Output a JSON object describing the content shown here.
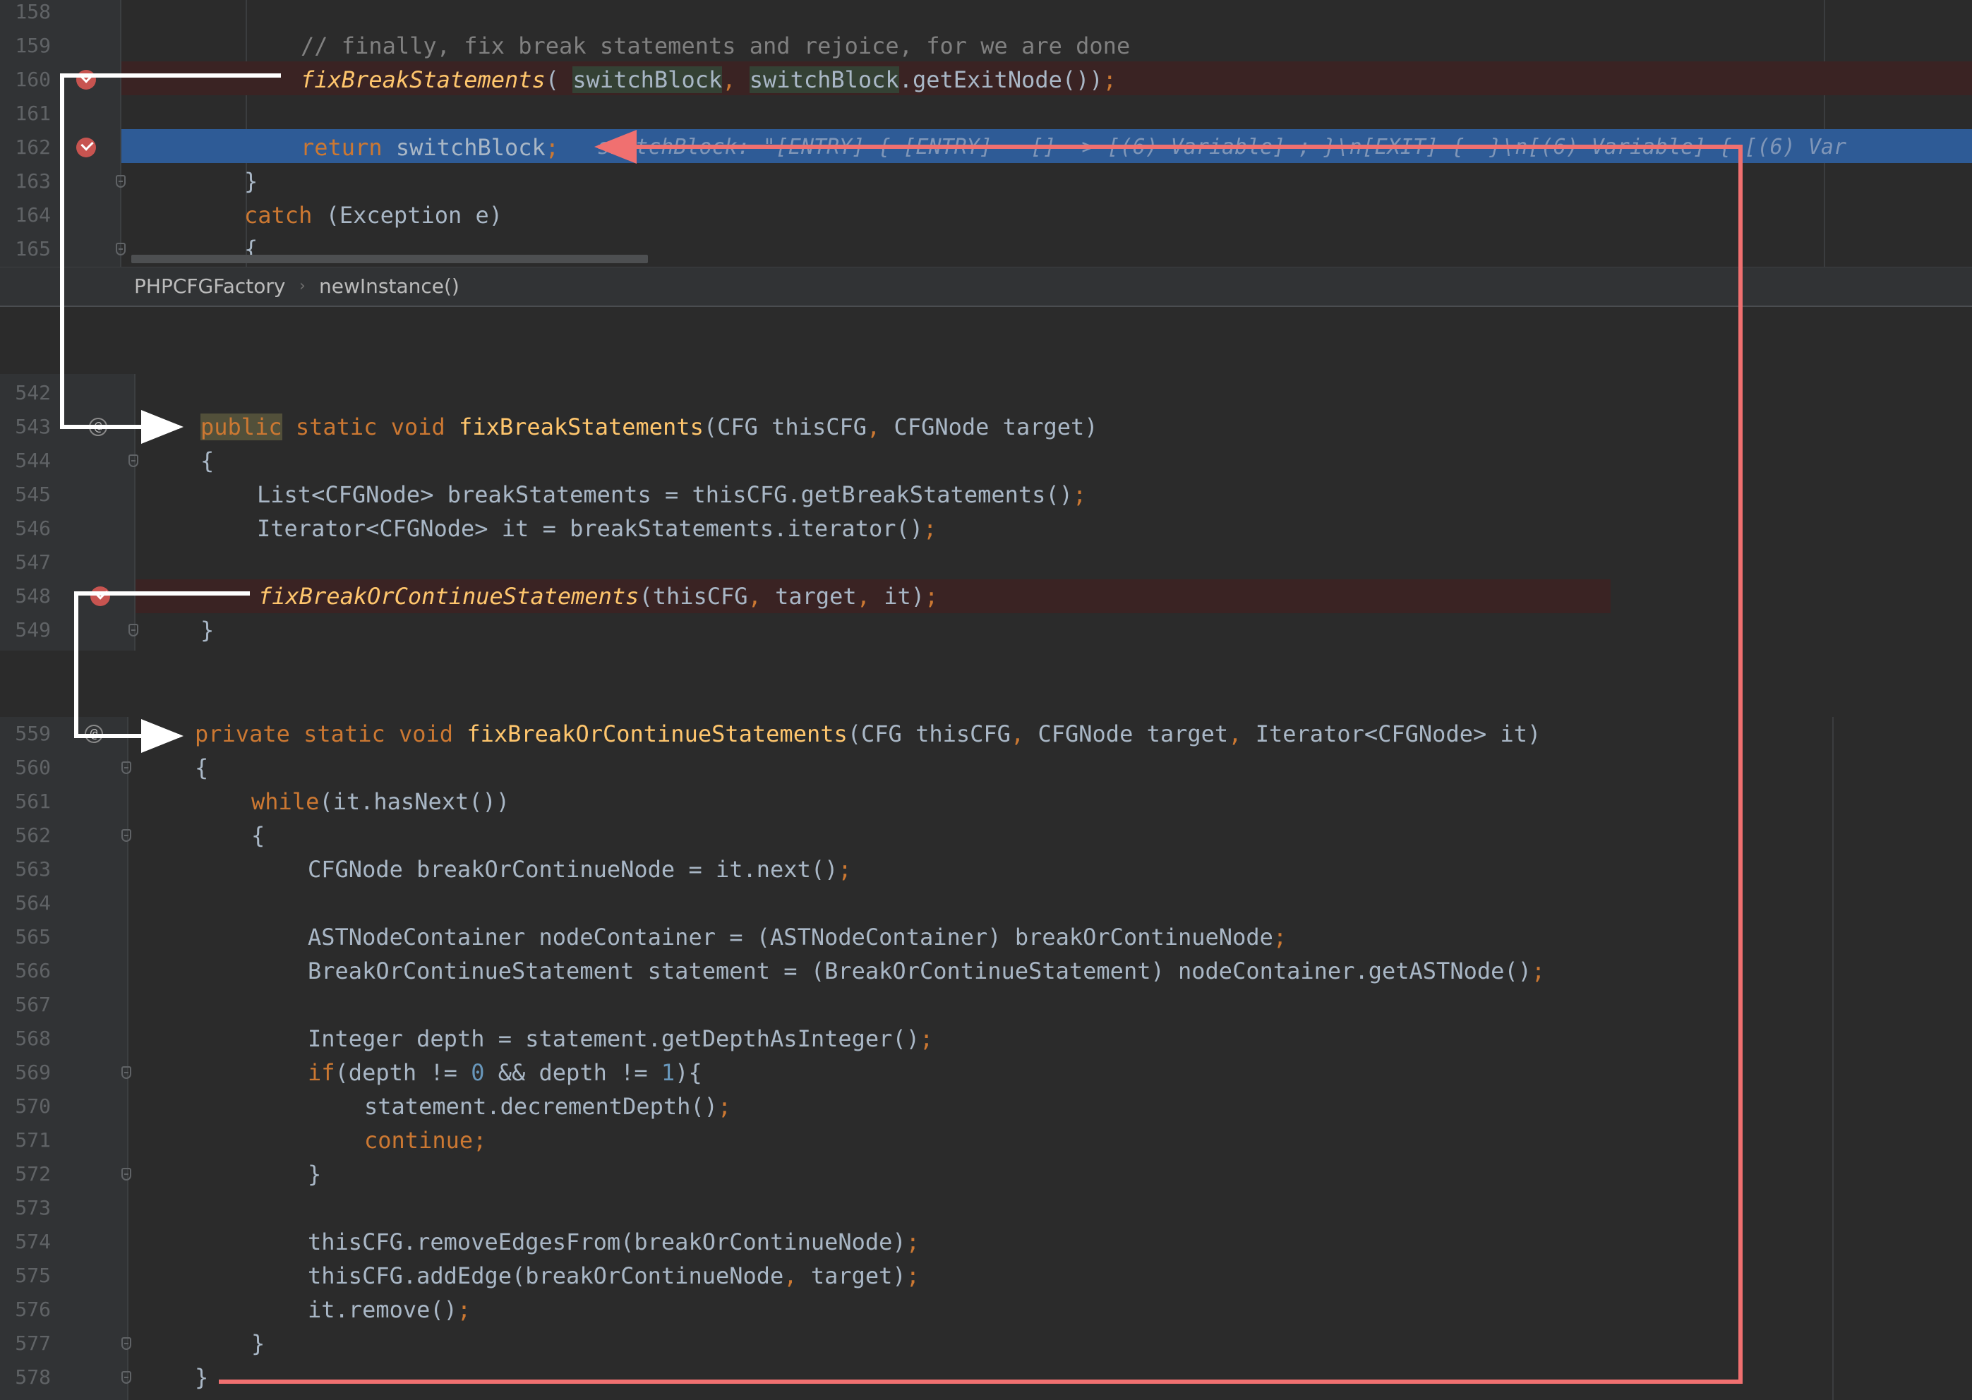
{
  "breadcrumb": {
    "class_name": "PHPCFGFactory",
    "separator": "›",
    "method_name": "newInstance()"
  },
  "icons": {
    "breakpoint": "breakpoint-verified-icon",
    "fold": "fold-icon",
    "override": "overrides-method-icon",
    "annotation_arrow": "arrow-icon"
  },
  "colors": {
    "background": "#2b2b2b",
    "keyword": "#cc7832",
    "method": "#ffc66d",
    "comment": "#808080",
    "number": "#6897bb",
    "breakpoint": "#c75450",
    "execution_line": "#2e5b96",
    "annotation_white": "#ffffff",
    "annotation_red": "#f07070"
  },
  "top_editor": {
    "lines": [
      {
        "no": "158",
        "comment": ""
      },
      {
        "no": "159",
        "comment": "// finally, fix break statements and rejoice, for we are done"
      },
      {
        "no": "160",
        "method": "fixBreakStatements",
        "p1": "( ",
        "arg1": "switchBlock",
        "comma1": ", ",
        "arg2": "switchBlock",
        "rest": ".getExitNode())",
        "semi": ";"
      },
      {
        "no": "161"
      },
      {
        "no": "162",
        "kw": "return",
        "rest": " switchBlock",
        "semi": ";",
        "inlay": "switchBlock: \"[ENTRY] { [ENTRY] --[]--> [(6) Variable] ; }\\n[EXIT] {  }\\n[(6) Variable] { [(6) Var"
      },
      {
        "no": "163",
        "text": "}"
      },
      {
        "no": "164",
        "kw": "catch",
        "rest": " (Exception e)"
      },
      {
        "no": "165",
        "text": "{"
      }
    ]
  },
  "middle_editor": {
    "lines": [
      {
        "no": "542"
      },
      {
        "no": "543",
        "kw1": "public",
        "kw2": " static void ",
        "method": "fixBreakStatements",
        "rest1": "(CFG thisCFG",
        "comma": ", ",
        "rest2": "CFGNode target)"
      },
      {
        "no": "544",
        "text": "{"
      },
      {
        "no": "545",
        "text": "List<CFGNode> breakStatements = thisCFG.getBreakStatements()",
        "semi": ";"
      },
      {
        "no": "546",
        "text": "Iterator<CFGNode> it = breakStatements.iterator()",
        "semi": ";"
      },
      {
        "no": "547"
      },
      {
        "no": "548",
        "method": "fixBreakOrContinueStatements",
        "p1": "(thisCFG",
        "c1": ", ",
        "p2": "target",
        "c2": ", ",
        "p3": "it)",
        "semi": ";"
      },
      {
        "no": "549",
        "text": "}"
      }
    ]
  },
  "bottom_editor": {
    "lines": [
      {
        "no": "559",
        "kw": "private static void ",
        "method": "fixBreakOrContinueStatements",
        "rest1": "(CFG thisCFG",
        "c1": ", ",
        "rest2": "CFGNode target",
        "c2": ", ",
        "rest3": "Iterator<CFGNode> it)"
      },
      {
        "no": "560",
        "text": "{"
      },
      {
        "no": "561",
        "kw": "while",
        "rest": "(it.hasNext())"
      },
      {
        "no": "562",
        "text": "{"
      },
      {
        "no": "563",
        "text": "CFGNode breakOrContinueNode = it.next()",
        "semi": ";"
      },
      {
        "no": "564"
      },
      {
        "no": "565",
        "text": "ASTNodeContainer nodeContainer = (ASTNodeContainer) breakOrContinueNode",
        "semi": ";"
      },
      {
        "no": "566",
        "text": "BreakOrContinueStatement statement = (BreakOrContinueStatement) nodeContainer.getASTNode()",
        "semi": ";"
      },
      {
        "no": "567"
      },
      {
        "no": "568",
        "text": "Integer depth = statement.getDepthAsInteger()",
        "semi": ";"
      },
      {
        "no": "569",
        "kw": "if",
        "a": "(depth != ",
        "n1": "0",
        "b": " && depth != ",
        "n2": "1",
        "c": "){"
      },
      {
        "no": "570",
        "text": "statement.decrementDepth()",
        "semi": ";"
      },
      {
        "no": "571",
        "kw": "continue",
        "semi": ";"
      },
      {
        "no": "572",
        "text": "}"
      },
      {
        "no": "573"
      },
      {
        "no": "574",
        "text": "thisCFG.removeEdgesFrom(breakOrContinueNode)",
        "semi": ";"
      },
      {
        "no": "575",
        "a": "thisCFG.addEdge(breakOrContinueNode",
        "c": ", ",
        "b": "target)",
        "semi": ";"
      },
      {
        "no": "576",
        "text": "it.remove()",
        "semi": ";"
      },
      {
        "no": "577",
        "text": "}"
      },
      {
        "no": "578",
        "text": "}"
      }
    ]
  }
}
